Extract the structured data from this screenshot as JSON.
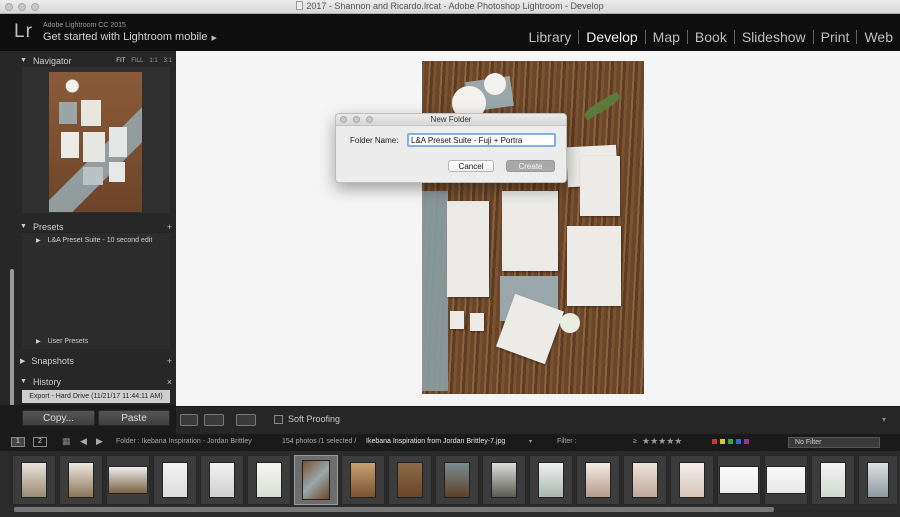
{
  "window": {
    "title": "2017 - Shannon and Ricardo.lrcat - Adobe Photoshop Lightroom - Develop"
  },
  "identity": {
    "logo": "Lr",
    "app_name": "Adobe Lightroom CC 2015",
    "mobile_label": "Get started with Lightroom mobile"
  },
  "modules": [
    "Library",
    "Develop",
    "Map",
    "Book",
    "Slideshow",
    "Print",
    "Web"
  ],
  "active_module": "Develop",
  "left_panel": {
    "navigator": {
      "title": "Navigator",
      "zoom": [
        "FIT",
        "FILL",
        "1:1",
        "3:1"
      ]
    },
    "presets": {
      "title": "Presets",
      "add": "+",
      "items": [
        "L&A Preset Suite - 10 second edit",
        "User Presets"
      ]
    },
    "snapshots": {
      "title": "Snapshots",
      "add": "+"
    },
    "history": {
      "title": "History",
      "clear": "×",
      "items": [
        "Export - Hard Drive (11/21/17 11:44:11 AM)"
      ]
    },
    "copy_label": "Copy...",
    "paste_label": "Paste"
  },
  "dialog": {
    "title": "New Folder",
    "field_label": "Folder Name:",
    "field_value": "L&A Preset Suite - Fuji + Portra",
    "cancel_label": "Cancel",
    "create_label": "Create"
  },
  "toolbar": {
    "soft_proofing_label": "Soft Proofing"
  },
  "filmstrip_bar": {
    "page1": "1",
    "page2": "2",
    "folder": "Folder : Ikebana Inspiration - Jordan Brittley",
    "count": "154 photos /1 selected /",
    "file": "Ikebana Inspiration from Jordan Brittley-7.jpg",
    "filter_label": "Filter :",
    "rating_op": "≥",
    "stars": "★★★★★",
    "no_filter": "No Filter"
  },
  "colors": {
    "accent_selection": "#6d6d6d",
    "dialog_focus": "#7fb0e8",
    "panel_bg": "#272727"
  }
}
